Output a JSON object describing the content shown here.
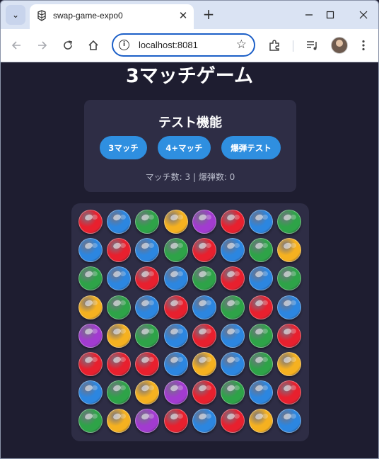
{
  "browser": {
    "tab_title": "swap-game-expo0",
    "url": "localhost:8081",
    "new_tab_glyph": "+",
    "close_glyph": "✕"
  },
  "game": {
    "title": "3マッチゲーム",
    "panel": {
      "title": "テスト機能",
      "buttons": [
        "3マッチ",
        "4+マッチ",
        "爆弾テスト"
      ],
      "status": "マッチ数: 3 | 爆弾数: 0"
    },
    "gem_colors": {
      "red": "#e8202e",
      "blue": "#2c86e0",
      "green": "#2ea348",
      "yellow": "#f5b120",
      "purple": "#a23bd0"
    },
    "board": [
      [
        "red",
        "blue",
        "green",
        "yellow",
        "purple",
        "red",
        "blue",
        "green"
      ],
      [
        "blue",
        "red",
        "blue",
        "green",
        "red",
        "blue",
        "green",
        "yellow"
      ],
      [
        "green",
        "blue",
        "red",
        "blue",
        "green",
        "red",
        "blue",
        "green"
      ],
      [
        "yellow",
        "green",
        "blue",
        "red",
        "blue",
        "green",
        "red",
        "blue"
      ],
      [
        "purple",
        "yellow",
        "green",
        "blue",
        "red",
        "blue",
        "green",
        "red"
      ],
      [
        "red",
        "red",
        "red",
        "blue",
        "yellow",
        "blue",
        "green",
        "yellow"
      ],
      [
        "blue",
        "green",
        "yellow",
        "purple",
        "red",
        "green",
        "blue",
        "red"
      ],
      [
        "green",
        "yellow",
        "purple",
        "red",
        "blue",
        "red",
        "yellow",
        "blue"
      ]
    ]
  }
}
